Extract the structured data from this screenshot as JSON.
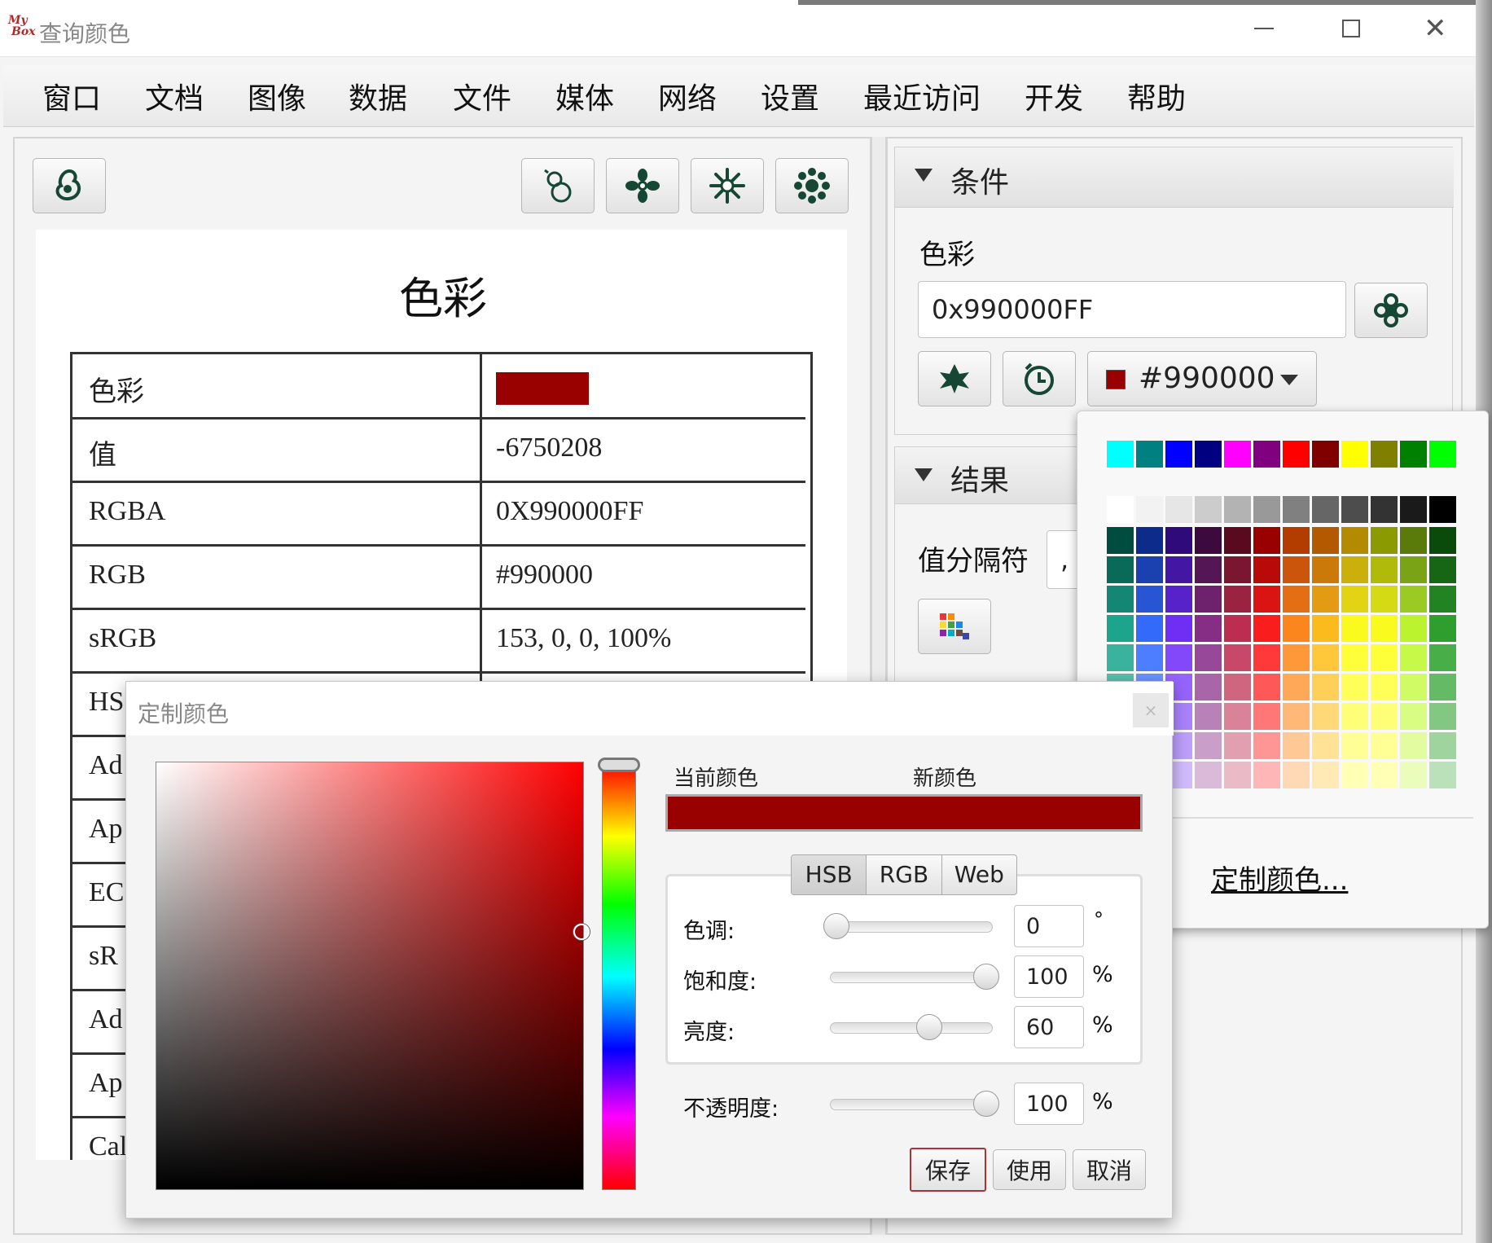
{
  "window": {
    "title": "查询颜色",
    "logo_top": "My",
    "logo_bottom": "Box"
  },
  "menu": [
    "窗口",
    "文档",
    "图像",
    "数据",
    "文件",
    "媒体",
    "网络",
    "设置",
    "最近访问",
    "开发",
    "帮助"
  ],
  "document": {
    "heading": "色彩",
    "rows": [
      {
        "label": "色彩",
        "value": ""
      },
      {
        "label": "值",
        "value": "-6750208"
      },
      {
        "label": "RGBA",
        "value": "0X990000FF"
      },
      {
        "label": "RGB",
        "value": "#990000"
      },
      {
        "label": "sRGB",
        "value": "153, 0, 0, 100%"
      },
      {
        "label": "HS",
        "value": ""
      },
      {
        "label": "Ad",
        "value": ""
      },
      {
        "label": "Ap",
        "value": ""
      },
      {
        "label": "EC",
        "value": ""
      },
      {
        "label": "sR",
        "value": ""
      },
      {
        "label": "Ad",
        "value": ""
      },
      {
        "label": "Ap",
        "value": ""
      },
      {
        "label": "Cal",
        "value": ""
      }
    ],
    "swatch_color": "#990000"
  },
  "conditions": {
    "title": "条件",
    "color_label": "色彩",
    "color_value": "0x990000FF",
    "picker_value": "#990000"
  },
  "results": {
    "title": "结果",
    "separator_label": "值分隔符",
    "separator_value": ","
  },
  "palette": {
    "link": "定制颜色...",
    "top_row": [
      "#00FFFF",
      "#008080",
      "#0000FF",
      "#000080",
      "#FF00FF",
      "#800080",
      "#FF0000",
      "#800000",
      "#FFFF00",
      "#808000",
      "#008000",
      "#00FF00"
    ],
    "gray_row": [
      "#FFFFFF",
      "#F2F2F2",
      "#E6E6E6",
      "#CCCCCC",
      "#B3B3B3",
      "#999999",
      "#808080",
      "#666666",
      "#4D4D4D",
      "#333333",
      "#1A1A1A",
      "#000000"
    ],
    "hue_columns": [
      "#004D40",
      "#0D2C8A",
      "#2E0A7A",
      "#3C0A3C",
      "#5A0A1E",
      "#990000",
      "#B33C00",
      "#B35A00",
      "#B38A00",
      "#8A9A00",
      "#5A7A0A",
      "#0A4A0A"
    ]
  },
  "custom_dialog": {
    "title": "定制颜色",
    "current_label": "当前颜色",
    "new_label": "新颜色",
    "tabs": [
      "HSB",
      "RGB",
      "Web"
    ],
    "hue_label": "色调:",
    "hue_value": "0",
    "hue_unit": "°",
    "sat_label": "饱和度:",
    "sat_value": "100",
    "sat_unit": "%",
    "bri_label": "亮度:",
    "bri_value": "60",
    "bri_unit": "%",
    "opacity_label": "不透明度:",
    "opacity_value": "100",
    "opacity_unit": "%",
    "save": "保存",
    "use": "使用",
    "cancel": "取消",
    "close": "×",
    "current_color": "#990000",
    "new_color": "#990000"
  }
}
